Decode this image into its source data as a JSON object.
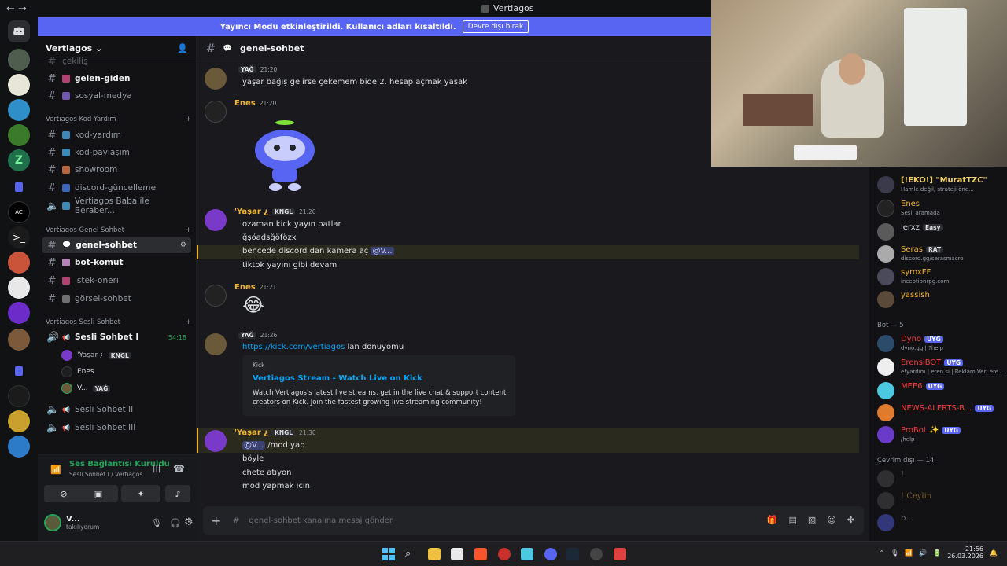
{
  "window": {
    "title": "Vertiagos",
    "back": "←",
    "forward": "→"
  },
  "banner": {
    "text": "Yayıncı Modu etkinleştirildi. Kullanıcı adları kısaltıldı.",
    "button": "Devre dışı bırak"
  },
  "server": {
    "name": "Vertiagos"
  },
  "channels": {
    "top": [
      {
        "name": "çekiliş"
      },
      {
        "name": "gelen-giden"
      },
      {
        "name": "sosyal-medya"
      }
    ],
    "categories": [
      {
        "name": "Vertiagos Kod Yardım",
        "items": [
          "kod-yardım",
          "kod-paylaşım",
          "showroom",
          "discord-güncelleme",
          "Vertiagos Baba ile Beraber..."
        ]
      },
      {
        "name": "Vertiagos Genel Sohbet",
        "items": [
          "genel-sohbet",
          "bot-komut",
          "istek-öneri",
          "görsel-sohbet"
        ]
      },
      {
        "name": "Vertiagos Sesli Sohbet",
        "items": [
          "Sesli Sohbet I",
          "Sesli Sohbet II",
          "Sesli Sohbet III"
        ]
      }
    ],
    "voice_timer": "54:18",
    "voice_users": [
      {
        "name": "'Yaşar ¿",
        "tag": "KNGL"
      },
      {
        "name": "Enes",
        "tag": ""
      },
      {
        "name": "V...",
        "tag": "YAĞ"
      }
    ]
  },
  "voice_panel": {
    "status": "Ses Bağlantısı Kuruldu",
    "location": "Sesli Sohbet I / Vertiagos"
  },
  "user": {
    "name": "V...",
    "status": "takılıyorum"
  },
  "chat": {
    "channel": "genel-sohbet",
    "messages": [
      {
        "author": "",
        "tag": "YAĞ",
        "time": "21:20",
        "lines": [
          "yaşar bağış gelirse çekemem bide 2. hesap açmak yasak"
        ]
      },
      {
        "author": "Enes",
        "time": "21:20",
        "sticker": "discord-clyde-thinking"
      },
      {
        "author": "'Yaşar ¿",
        "tag": "KNGL",
        "time": "21:20",
        "lines": [
          "ozaman kick yayın patlar",
          "ğşöadsğöfözx",
          "bencede discord dan kamera aç",
          "tiktok yayını gibi devam"
        ],
        "mention": "@V..."
      },
      {
        "author": "Enes",
        "time": "21:21",
        "emoji": "😂"
      },
      {
        "author": "",
        "tag": "YAĞ",
        "time": "21:26",
        "link": "https://kick.com/vertiagos",
        "after_link": " lan donuyomu",
        "embed": {
          "provider": "Kick",
          "title": "Vertiagos Stream - Watch Live on Kick",
          "desc": "Watch Vertiagos's latest live streams, get in the live chat & support content creators on Kick. Join the fastest growing live streaming community!"
        }
      },
      {
        "author": "'Yaşar ¿",
        "tag": "KNGL",
        "time": "21:30",
        "mention": "@V...",
        "lines": [
          "/mod  yap",
          "böyle",
          "chete atıyon",
          "mod yapmak ıcın"
        ]
      }
    ],
    "placeholder": "genel-sohbet kanalına mesaj gönder"
  },
  "members": {
    "online": [
      {
        "name": "[!EKO!] \"MuratTZC\"",
        "status": "Hamle değil, strateji öne..."
      },
      {
        "name": "Enes",
        "status": "Sesli aramada"
      },
      {
        "name": "lerxz",
        "badge": "Easy",
        "status": ""
      },
      {
        "name": "Seras",
        "badge": "RAT",
        "status": "discord.gg/serasmacro"
      },
      {
        "name": "syroxFF",
        "status": "inceptionrpg.com"
      },
      {
        "name": "yassish",
        "status": ""
      }
    ],
    "bot_header": "Bot — 5",
    "bots": [
      {
        "name": "Dyno",
        "badge": "UYG",
        "status": "dyno.gg | ?help",
        "color": "#f23f43"
      },
      {
        "name": "ErensiBOT",
        "badge": "UYG",
        "status": "e!yardım | eren.si | Reklam Ver: ere...",
        "color": "#f23f43"
      },
      {
        "name": "MEE6",
        "badge": "UYG",
        "status": "",
        "color": "#f23f43"
      },
      {
        "name": "NEWS-ALERTS-B...",
        "badge": "UYG",
        "status": "",
        "color": "#f23f43"
      },
      {
        "name": "ProBot ✨",
        "badge": "UYG",
        "status": "/help",
        "color": "#f23f43"
      }
    ],
    "offline_header": "Çevrim dışı — 14",
    "offline": [
      {
        "name": "!"
      },
      {
        "name": "! Ceylin"
      },
      {
        "name": "b..."
      }
    ]
  },
  "taskbar": {
    "time": "21:56",
    "date": "26.03.2026"
  },
  "colors": {
    "blurple": "#5865f2",
    "green": "#23a55a",
    "mention": "#f0b232",
    "link": "#00a8fc"
  }
}
